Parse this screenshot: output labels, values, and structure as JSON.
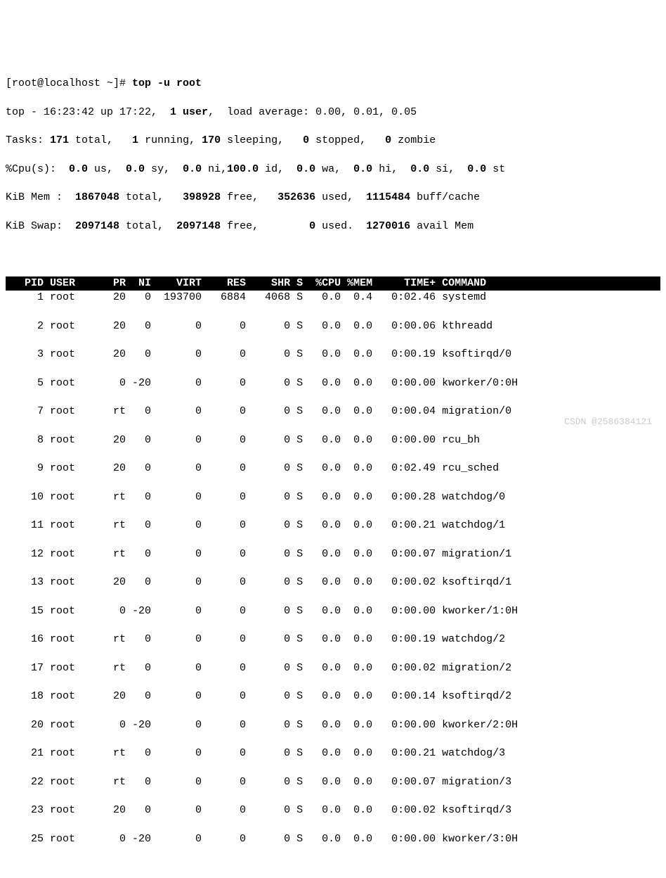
{
  "prompt": "[root@localhost ~]# ",
  "command": "top -u root",
  "summary": {
    "line1_a": "top - 16:23:42 up 17:22,  ",
    "line1_b": "1 user",
    "line1_c": ",  load average: 0.00, 0.01, 0.05",
    "line2_a": "Tasks: ",
    "line2_b": "171",
    "line2_c": " total,   ",
    "line2_d": "1",
    "line2_e": " running, ",
    "line2_f": "170",
    "line2_g": " sleeping,   ",
    "line2_h": "0",
    "line2_i": " stopped,   ",
    "line2_j": "0",
    "line2_k": " zombie",
    "line3_a": "%Cpu(s):  ",
    "line3_b": "0.0",
    "line3_c": " us,  ",
    "line3_d": "0.0",
    "line3_e": " sy,  ",
    "line3_f": "0.0",
    "line3_g": " ni,",
    "line3_h": "100.0",
    "line3_i": " id,  ",
    "line3_j": "0.0",
    "line3_k": " wa,  ",
    "line3_l": "0.0",
    "line3_m": " hi,  ",
    "line3_n": "0.0",
    "line3_o": " si,  ",
    "line3_p": "0.0",
    "line3_q": " st",
    "line4_a": "KiB Mem :  ",
    "line4_b": "1867048",
    "line4_c": " total,   ",
    "line4_d": "398928",
    "line4_e": " free,   ",
    "line4_f": "352636",
    "line4_g": " used,  ",
    "line4_h": "1115484",
    "line4_i": " buff/cache",
    "line5_a": "KiB Swap:  ",
    "line5_b": "2097148",
    "line5_c": " total,  ",
    "line5_d": "2097148",
    "line5_e": " free,        ",
    "line5_f": "0",
    "line5_g": " used.  ",
    "line5_h": "1270016",
    "line5_i": " avail Mem"
  },
  "table_header": "   PID USER      PR  NI    VIRT    RES    SHR S  %CPU %MEM     TIME+ COMMAND                 ",
  "rows": [
    "     1 root      20   0  193700   6884   4068 S   0.0  0.4   0:02.46 systemd",
    "     2 root      20   0       0      0      0 S   0.0  0.0   0:00.06 kthreadd",
    "     3 root      20   0       0      0      0 S   0.0  0.0   0:00.19 ksoftirqd/0",
    "     5 root       0 -20       0      0      0 S   0.0  0.0   0:00.00 kworker/0:0H",
    "     7 root      rt   0       0      0      0 S   0.0  0.0   0:00.04 migration/0",
    "     8 root      20   0       0      0      0 S   0.0  0.0   0:00.00 rcu_bh",
    "     9 root      20   0       0      0      0 S   0.0  0.0   0:02.49 rcu_sched",
    "    10 root      rt   0       0      0      0 S   0.0  0.0   0:00.28 watchdog/0",
    "    11 root      rt   0       0      0      0 S   0.0  0.0   0:00.21 watchdog/1",
    "    12 root      rt   0       0      0      0 S   0.0  0.0   0:00.07 migration/1",
    "    13 root      20   0       0      0      0 S   0.0  0.0   0:00.02 ksoftirqd/1",
    "    15 root       0 -20       0      0      0 S   0.0  0.0   0:00.00 kworker/1:0H",
    "    16 root      rt   0       0      0      0 S   0.0  0.0   0:00.19 watchdog/2",
    "    17 root      rt   0       0      0      0 S   0.0  0.0   0:00.02 migration/2",
    "    18 root      20   0       0      0      0 S   0.0  0.0   0:00.14 ksoftirqd/2",
    "    20 root       0 -20       0      0      0 S   0.0  0.0   0:00.00 kworker/2:0H",
    "    21 root      rt   0       0      0      0 S   0.0  0.0   0:00.21 watchdog/3",
    "    22 root      rt   0       0      0      0 S   0.0  0.0   0:00.07 migration/3",
    "    23 root      20   0       0      0      0 S   0.0  0.0   0:00.02 ksoftirqd/3",
    "    25 root       0 -20       0      0      0 S   0.0  0.0   0:00.00 kworker/3:0H"
  ],
  "watermark": "CSDN @2586384121"
}
